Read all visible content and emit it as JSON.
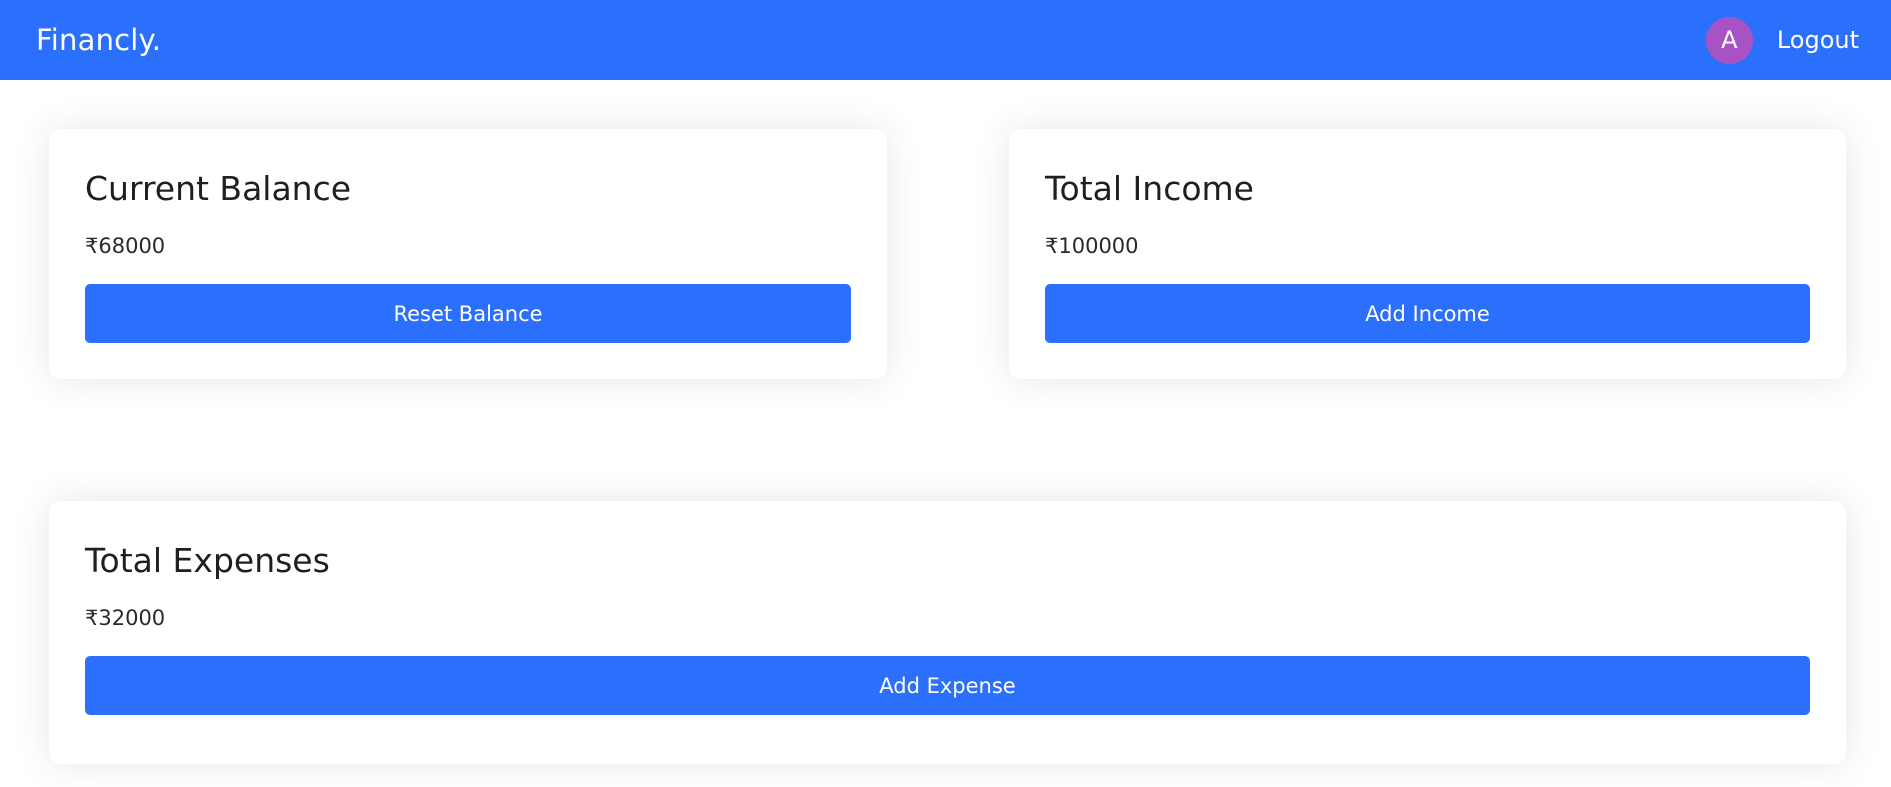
{
  "app": {
    "brand": "Financly.",
    "avatar_letter": "A",
    "logout_label": "Logout"
  },
  "colors": {
    "primary": "#2b6ffd",
    "avatar": "#a853c4",
    "card_bg": "#ffffff"
  },
  "cards": {
    "balance": {
      "title": "Current Balance",
      "value": "₹68000",
      "button": "Reset Balance"
    },
    "income": {
      "title": "Total Income",
      "value": "₹100000",
      "button": "Add Income"
    },
    "expenses": {
      "title": "Total Expenses",
      "value": "₹32000",
      "button": "Add Expense"
    }
  }
}
